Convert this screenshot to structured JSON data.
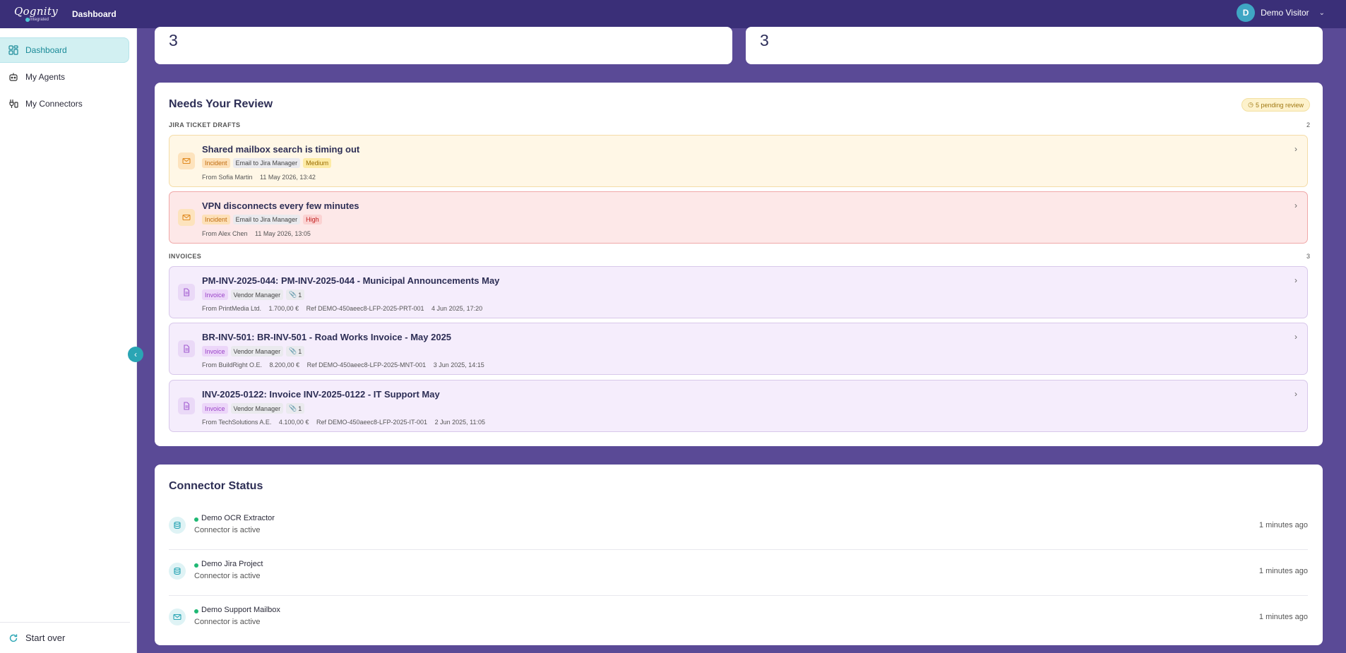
{
  "header": {
    "logo_text": "Qognity",
    "logo_subtext": "Integrated",
    "title": "Dashboard",
    "user_initial": "D",
    "user_name": "Demo Visitor"
  },
  "sidebar": {
    "items": [
      {
        "label": "Dashboard",
        "icon": "grid-icon",
        "active": true
      },
      {
        "label": "My Agents",
        "icon": "robot-icon",
        "active": false
      },
      {
        "label": "My Connectors",
        "icon": "plug-icon",
        "active": false
      }
    ],
    "start_over": "Start over"
  },
  "stats": {
    "left_value": "3",
    "right_value": "3"
  },
  "review": {
    "title": "Needs Your Review",
    "pending_badge": "5 pending review",
    "groups": [
      {
        "label": "JIRA TICKET DRAFTS",
        "count": "2",
        "items": [
          {
            "title": "Shared mailbox search is timing out",
            "tags": [
              "Incident",
              "Email to Jira Manager",
              "Medium"
            ],
            "from": "From Sofia Martin",
            "date": "11 May 2026, 13:42"
          },
          {
            "title": "VPN disconnects every few minutes",
            "tags": [
              "Incident",
              "Email to Jira Manager",
              "High"
            ],
            "from": "From Alex Chen",
            "date": "11 May 2026, 13:05"
          }
        ]
      },
      {
        "label": "INVOICES",
        "count": "3",
        "items": [
          {
            "title": "PM-INV-2025-044: PM-INV-2025-044 - Municipal Announcements May",
            "tags": [
              "Invoice",
              "Vendor Manager",
              "1"
            ],
            "from": "From PrintMedia Ltd.",
            "amount": "1.700,00 €",
            "ref": "Ref DEMO-450aeec8-LFP-2025-PRT-001",
            "date": "4 Jun 2025, 17:20"
          },
          {
            "title": "BR-INV-501: BR-INV-501 - Road Works Invoice - May 2025",
            "tags": [
              "Invoice",
              "Vendor Manager",
              "1"
            ],
            "from": "From BuildRight O.E.",
            "amount": "8.200,00 €",
            "ref": "Ref DEMO-450aeec8-LFP-2025-MNT-001",
            "date": "3 Jun 2025, 14:15"
          },
          {
            "title": "INV-2025-0122: Invoice INV-2025-0122 - IT Support May",
            "tags": [
              "Invoice",
              "Vendor Manager",
              "1"
            ],
            "from": "From TechSolutions A.E.",
            "amount": "4.100,00 €",
            "ref": "Ref DEMO-450aeec8-LFP-2025-IT-001",
            "date": "2 Jun 2025, 11:05"
          }
        ]
      }
    ]
  },
  "connectors": {
    "title": "Connector Status",
    "items": [
      {
        "name": "Demo OCR Extractor",
        "status": "Connector is active",
        "time": "1 minutes ago",
        "icon": "database-icon"
      },
      {
        "name": "Demo Jira Project",
        "status": "Connector is active",
        "time": "1 minutes ago",
        "icon": "database-icon"
      },
      {
        "name": "Demo Support Mailbox",
        "status": "Connector is active",
        "time": "1 minutes ago",
        "icon": "mail-icon"
      }
    ]
  }
}
